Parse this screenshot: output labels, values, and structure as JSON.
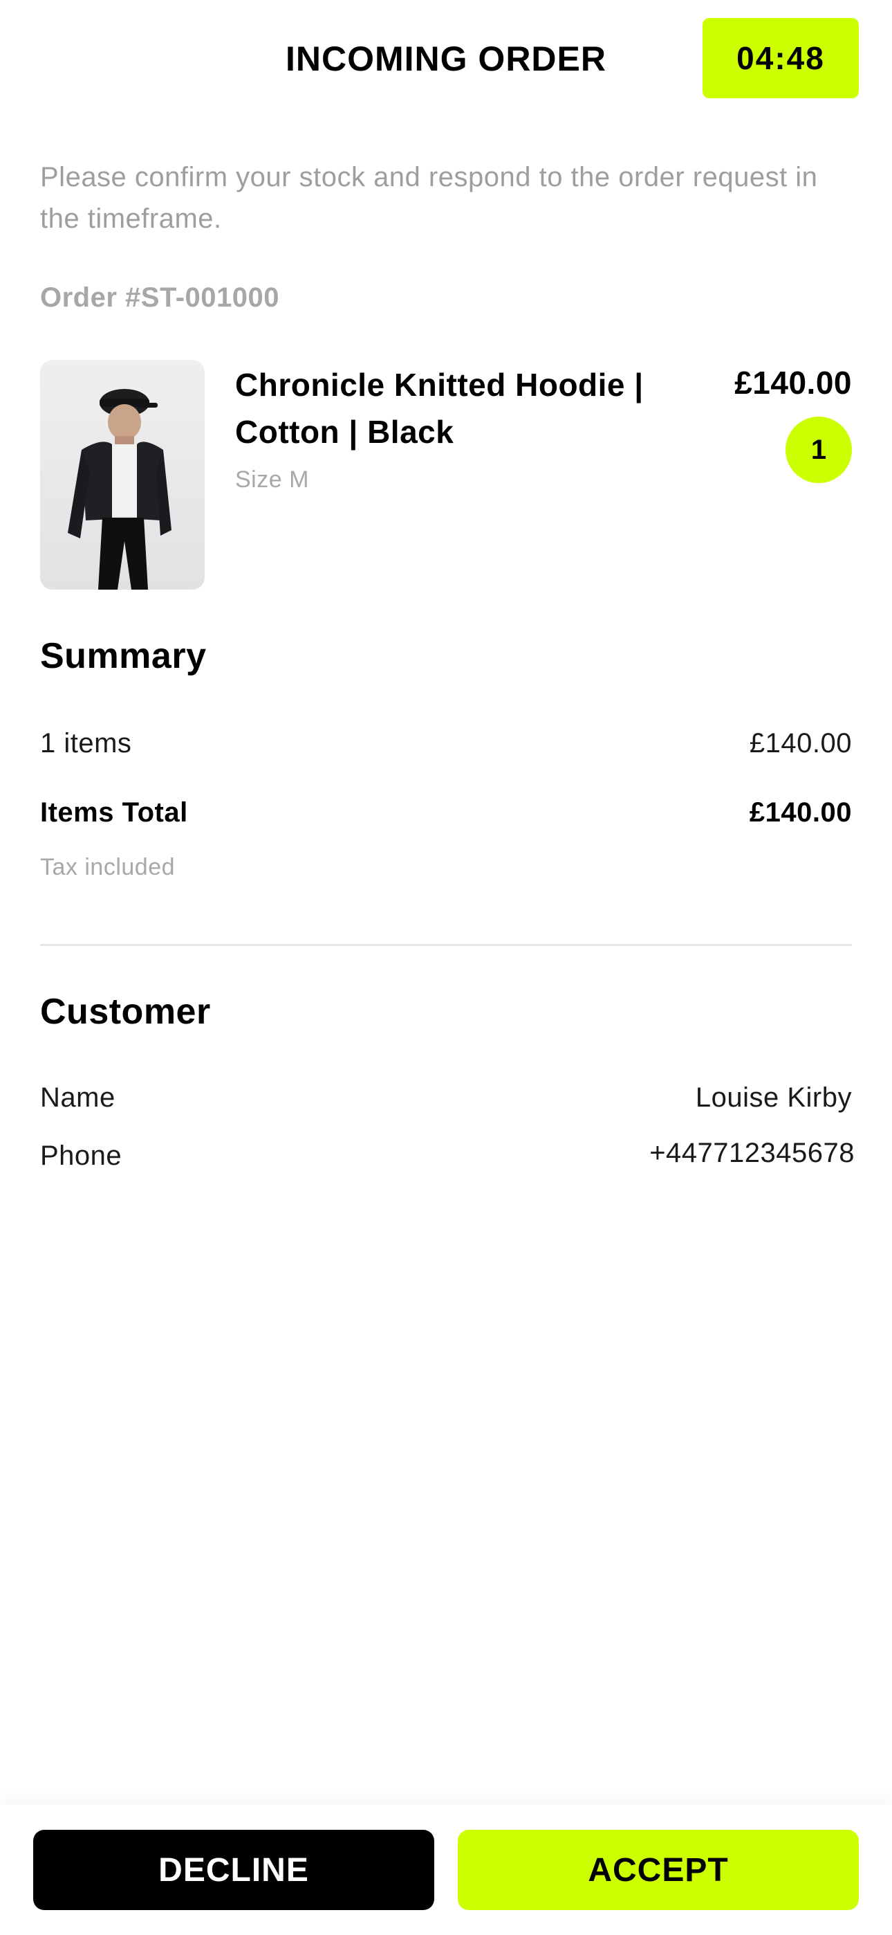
{
  "header": {
    "title": "INCOMING ORDER",
    "timer": "04:48"
  },
  "instructions": "Please confirm your stock and respond to the order request in the timeframe.",
  "order": {
    "number": "Order #ST-001000"
  },
  "product": {
    "name": "Chronicle Knitted Hoodie | Cotton | Black",
    "size": "Size M",
    "price": "£140.00",
    "quantity": "1"
  },
  "summary": {
    "heading": "Summary",
    "items_label": "1 items",
    "items_value": "£140.00",
    "total_label": "Items Total",
    "total_value": "£140.00",
    "tax_note": "Tax included"
  },
  "customer": {
    "heading": "Customer",
    "name_label": "Name",
    "name_value": "Louise Kirby",
    "phone_label": "Phone",
    "phone_value": "+447712345678"
  },
  "actions": {
    "decline": "DECLINE",
    "accept": "ACCEPT"
  },
  "colors": {
    "accent": "#ccff00",
    "primary_button": "#000000",
    "muted_text": "#9e9e9e"
  }
}
